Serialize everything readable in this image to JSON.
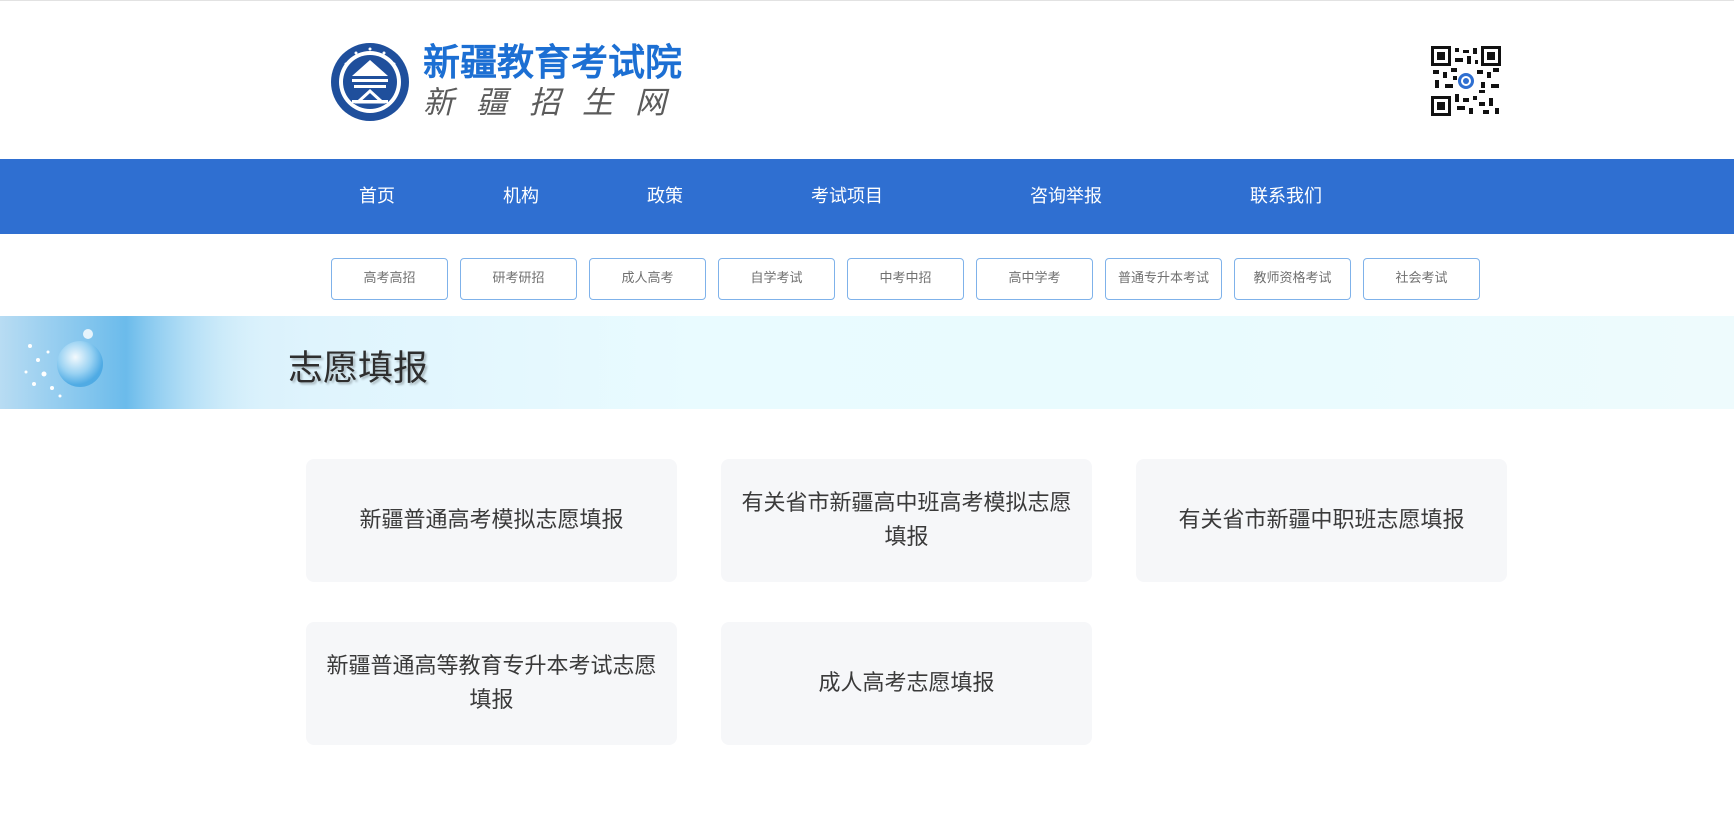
{
  "header": {
    "logo_title": "新疆教育考试院",
    "logo_subtitle": "新疆招生网",
    "seal_icon": "exam-institute-seal-icon",
    "qr_icon": "qr-code-icon"
  },
  "nav": {
    "items": [
      {
        "label": "首页"
      },
      {
        "label": "机构"
      },
      {
        "label": "政策"
      },
      {
        "label": "考试项目"
      },
      {
        "label": "咨询举报"
      },
      {
        "label": "联系我们"
      }
    ]
  },
  "subnav": {
    "items": [
      {
        "label": "高考高招"
      },
      {
        "label": "研考研招"
      },
      {
        "label": "成人高考"
      },
      {
        "label": "自学考试"
      },
      {
        "label": "中考中招"
      },
      {
        "label": "高中学考"
      },
      {
        "label": "普通专升本考试"
      },
      {
        "label": "教师资格考试"
      },
      {
        "label": "社会考试"
      }
    ]
  },
  "banner": {
    "title": "志愿填报"
  },
  "cards": [
    {
      "label": "新疆普通高考模拟志愿填报"
    },
    {
      "label": "有关省市新疆高中班高考模拟志愿填报"
    },
    {
      "label": "有关省市新疆中职班志愿填报"
    },
    {
      "label": "新疆普通高等教育专升本考试志愿填报"
    },
    {
      "label": "成人高考志愿填报"
    }
  ],
  "colors": {
    "brand_blue": "#1c6fd3",
    "nav_bg": "#2f6fd1",
    "pill_border": "#7fb2ea",
    "card_bg": "#f6f7f9"
  }
}
